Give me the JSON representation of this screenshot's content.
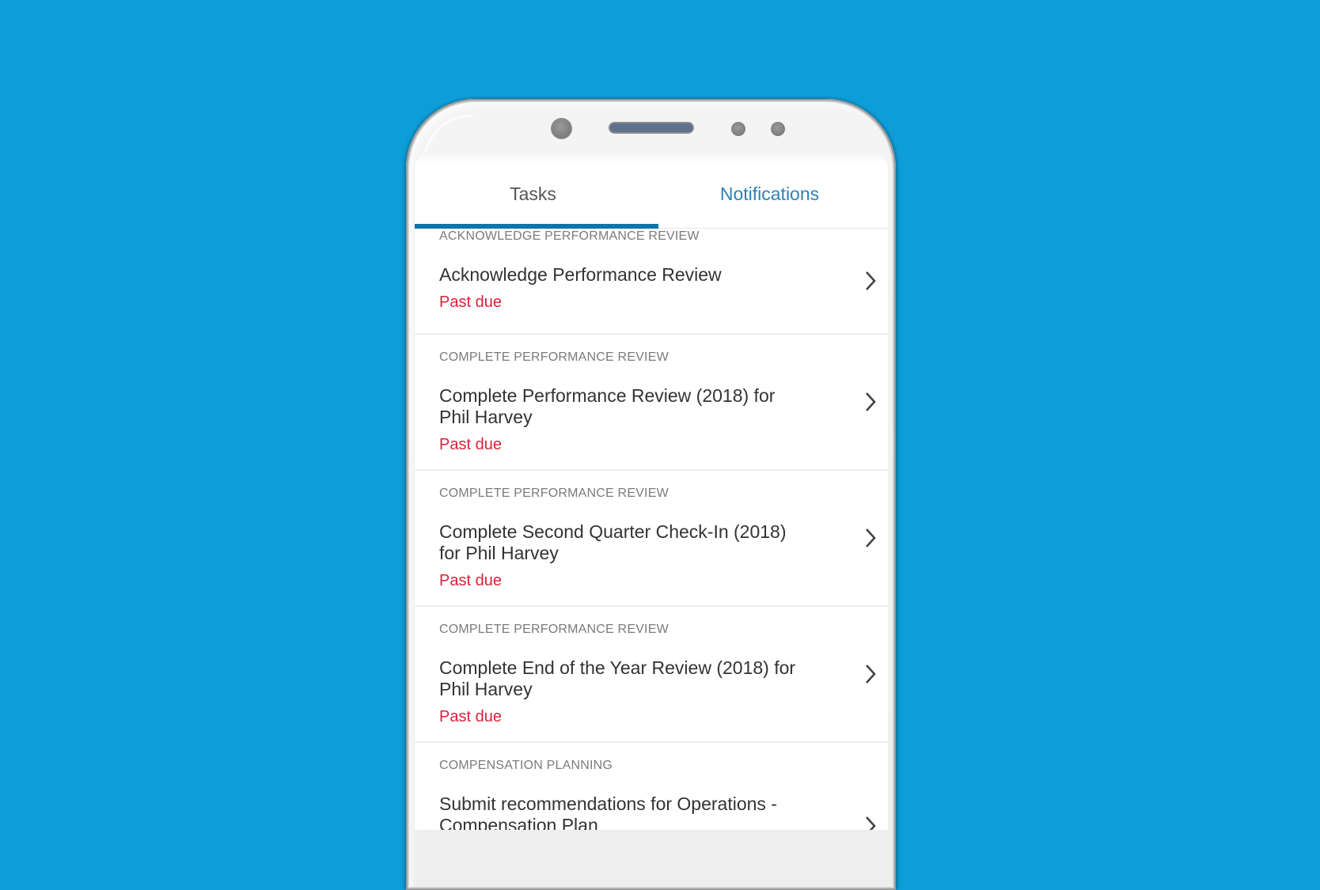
{
  "tabs": [
    {
      "label": "Tasks",
      "active": true
    },
    {
      "label": "Notifications",
      "active": false
    }
  ],
  "colors": {
    "background": "#0d9dd8",
    "tab_indicator": "#1174a8",
    "notifications_tab": "#2c82b6",
    "past_due": "#d9213c"
  },
  "tasks": [
    {
      "category": "ACKNOWLEDGE PERFORMANCE REVIEW",
      "title": "Acknowledge Performance Review",
      "status": "Past due"
    },
    {
      "category": "COMPLETE PERFORMANCE REVIEW",
      "title": "Complete Performance Review (2018) for Phil Harvey",
      "status": "Past due"
    },
    {
      "category": "COMPLETE PERFORMANCE REVIEW",
      "title": "Complete Second Quarter Check-In (2018) for Phil Harvey",
      "status": "Past due"
    },
    {
      "category": "COMPLETE PERFORMANCE REVIEW",
      "title": "Complete End of the Year Review (2018) for Phil Harvey",
      "status": "Past due"
    },
    {
      "category": "COMPENSATION PLANNING",
      "title": "Submit recommendations for Operations - Compensation Plan",
      "status": ""
    }
  ],
  "icons": {
    "row_chevron": "chevron-right-icon"
  }
}
